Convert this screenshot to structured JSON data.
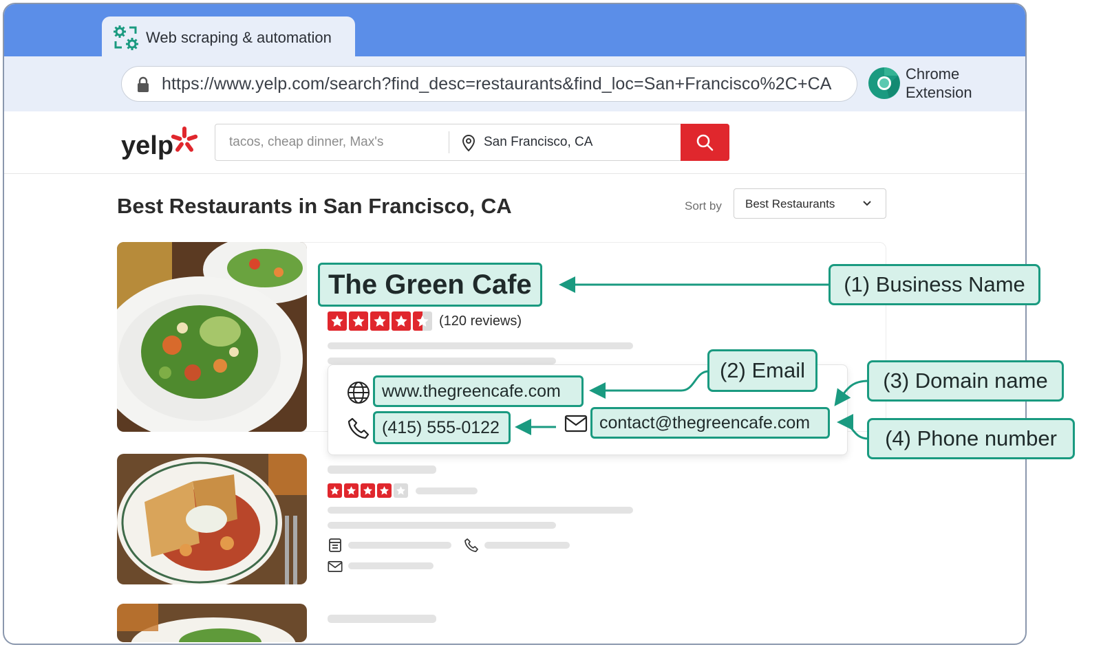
{
  "browser": {
    "tab_title": "Web scraping & automation",
    "url": "https://www.yelp.com/search?find_desc=restaurants&find_loc=San+Francisco%2C+CA",
    "extension_label_line1": "Chrome",
    "extension_label_line2": "Extension"
  },
  "yelp": {
    "logo_text": "yelp",
    "search_placeholder": "tacos, cheap dinner, Max's",
    "location_value": "San Francisco, CA"
  },
  "page": {
    "title": "Best Restaurants in San Francisco, CA",
    "sort_label": "Sort by",
    "sort_value": "Best Restaurants"
  },
  "listings": [
    {
      "name": "The Green Cafe",
      "rating": 4.5,
      "reviews": "(120 reviews)",
      "website": "www.thegreencafe.com",
      "phone": "(415) 555-0122",
      "email": "contact@thegreencafe.com"
    },
    {
      "rating": 4
    }
  ],
  "callouts": {
    "business_name": "(1) Business Name",
    "email": "(2) Email",
    "domain_name": "(3) Domain name",
    "phone_number": "(4) Phone number"
  },
  "colors": {
    "browser_titlebar": "#5b8ee8",
    "yelp_red": "#e0272d",
    "highlight_fill": "#d7f1ea",
    "highlight_border": "#1a9a80"
  }
}
